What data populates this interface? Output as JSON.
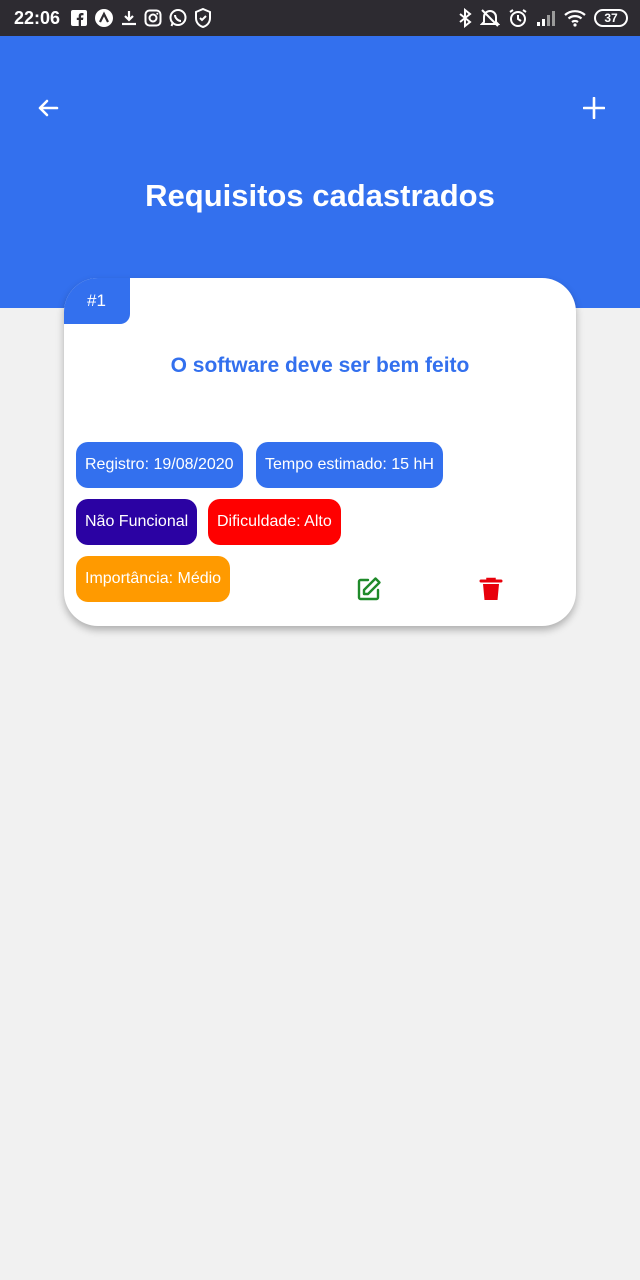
{
  "status_bar": {
    "time": "22:06",
    "battery": "37",
    "left_icons": [
      "facebook-icon",
      "nav-icon",
      "download-icon",
      "instagram-icon",
      "whatsapp-icon",
      "shield-icon"
    ],
    "right_icons": [
      "bluetooth-icon",
      "mute-icon",
      "alarm-icon",
      "signal-icon",
      "wifi-icon"
    ]
  },
  "header": {
    "title": "Requisitos cadastrados",
    "back_icon": "arrow-left-icon",
    "add_icon": "plus-icon",
    "background_color": "#3370ee"
  },
  "requirements": [
    {
      "number": "#1",
      "description": "O software deve ser bem feito",
      "registro": "Registro: 19/08/2020",
      "tempo": "Tempo estimado: 15 hH",
      "tipo": "Não Funcional",
      "dificuldade": "Dificuldade: Alto",
      "importancia": "Importância: Médio",
      "edit_icon": "edit-icon",
      "delete_icon": "trash-icon"
    }
  ],
  "colors": {
    "primary": "#3370ee",
    "tipo": "#2b02a3",
    "dificuldade": "#ff0000",
    "importancia": "#ff9a00",
    "edit": "#1f8a2a",
    "delete": "#e8000b"
  }
}
